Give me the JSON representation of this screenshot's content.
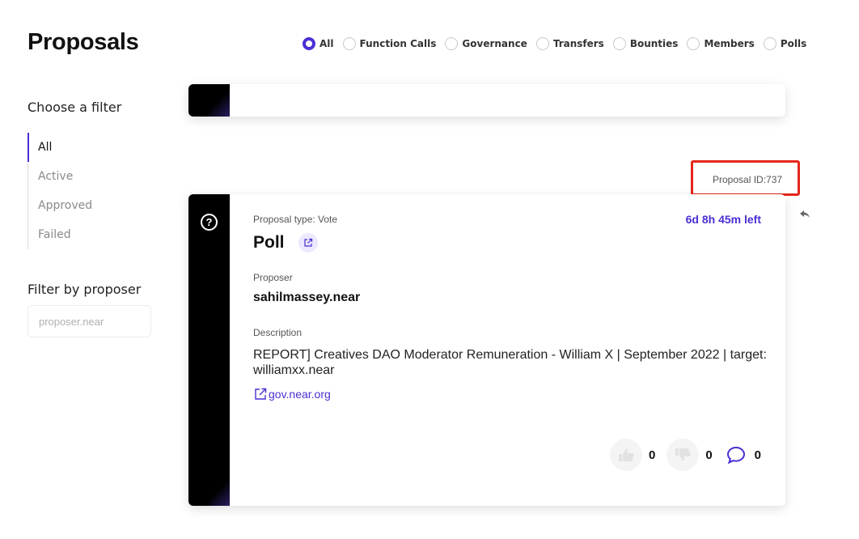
{
  "page": {
    "title": "Proposals"
  },
  "type_filters": {
    "selected": "All",
    "options": [
      "All",
      "Function Calls",
      "Governance",
      "Transfers",
      "Bounties",
      "Members",
      "Polls"
    ]
  },
  "sidebar": {
    "filter_heading": "Choose a filter",
    "filters": [
      "All",
      "Active",
      "Approved",
      "Failed"
    ],
    "active_filter": "All",
    "proposer_heading": "Filter by proposer",
    "proposer_placeholder": "proposer.near"
  },
  "proposal": {
    "id_label": "Proposal ID:737",
    "type_label": "Proposal type: Vote",
    "time_left": "6d 8h 45m left",
    "title": "Poll",
    "proposer_label": "Proposer",
    "proposer": "sahilmassey.near",
    "description_label": "Description",
    "description": "REPORT] Creatives DAO Moderator Remuneration - William X | September 2022 | target: williamxx.near",
    "link_text": "gov.near.org",
    "likes": "0",
    "dislikes": "0",
    "comments": "0"
  },
  "colors": {
    "accent": "#4b2fd4",
    "highlight": "#e5261b",
    "card_strip": "#000000"
  },
  "icons": [
    "help-icon",
    "external-link-icon",
    "reply-icon",
    "thumbs-up-icon",
    "thumbs-down-icon",
    "comment-icon"
  ]
}
